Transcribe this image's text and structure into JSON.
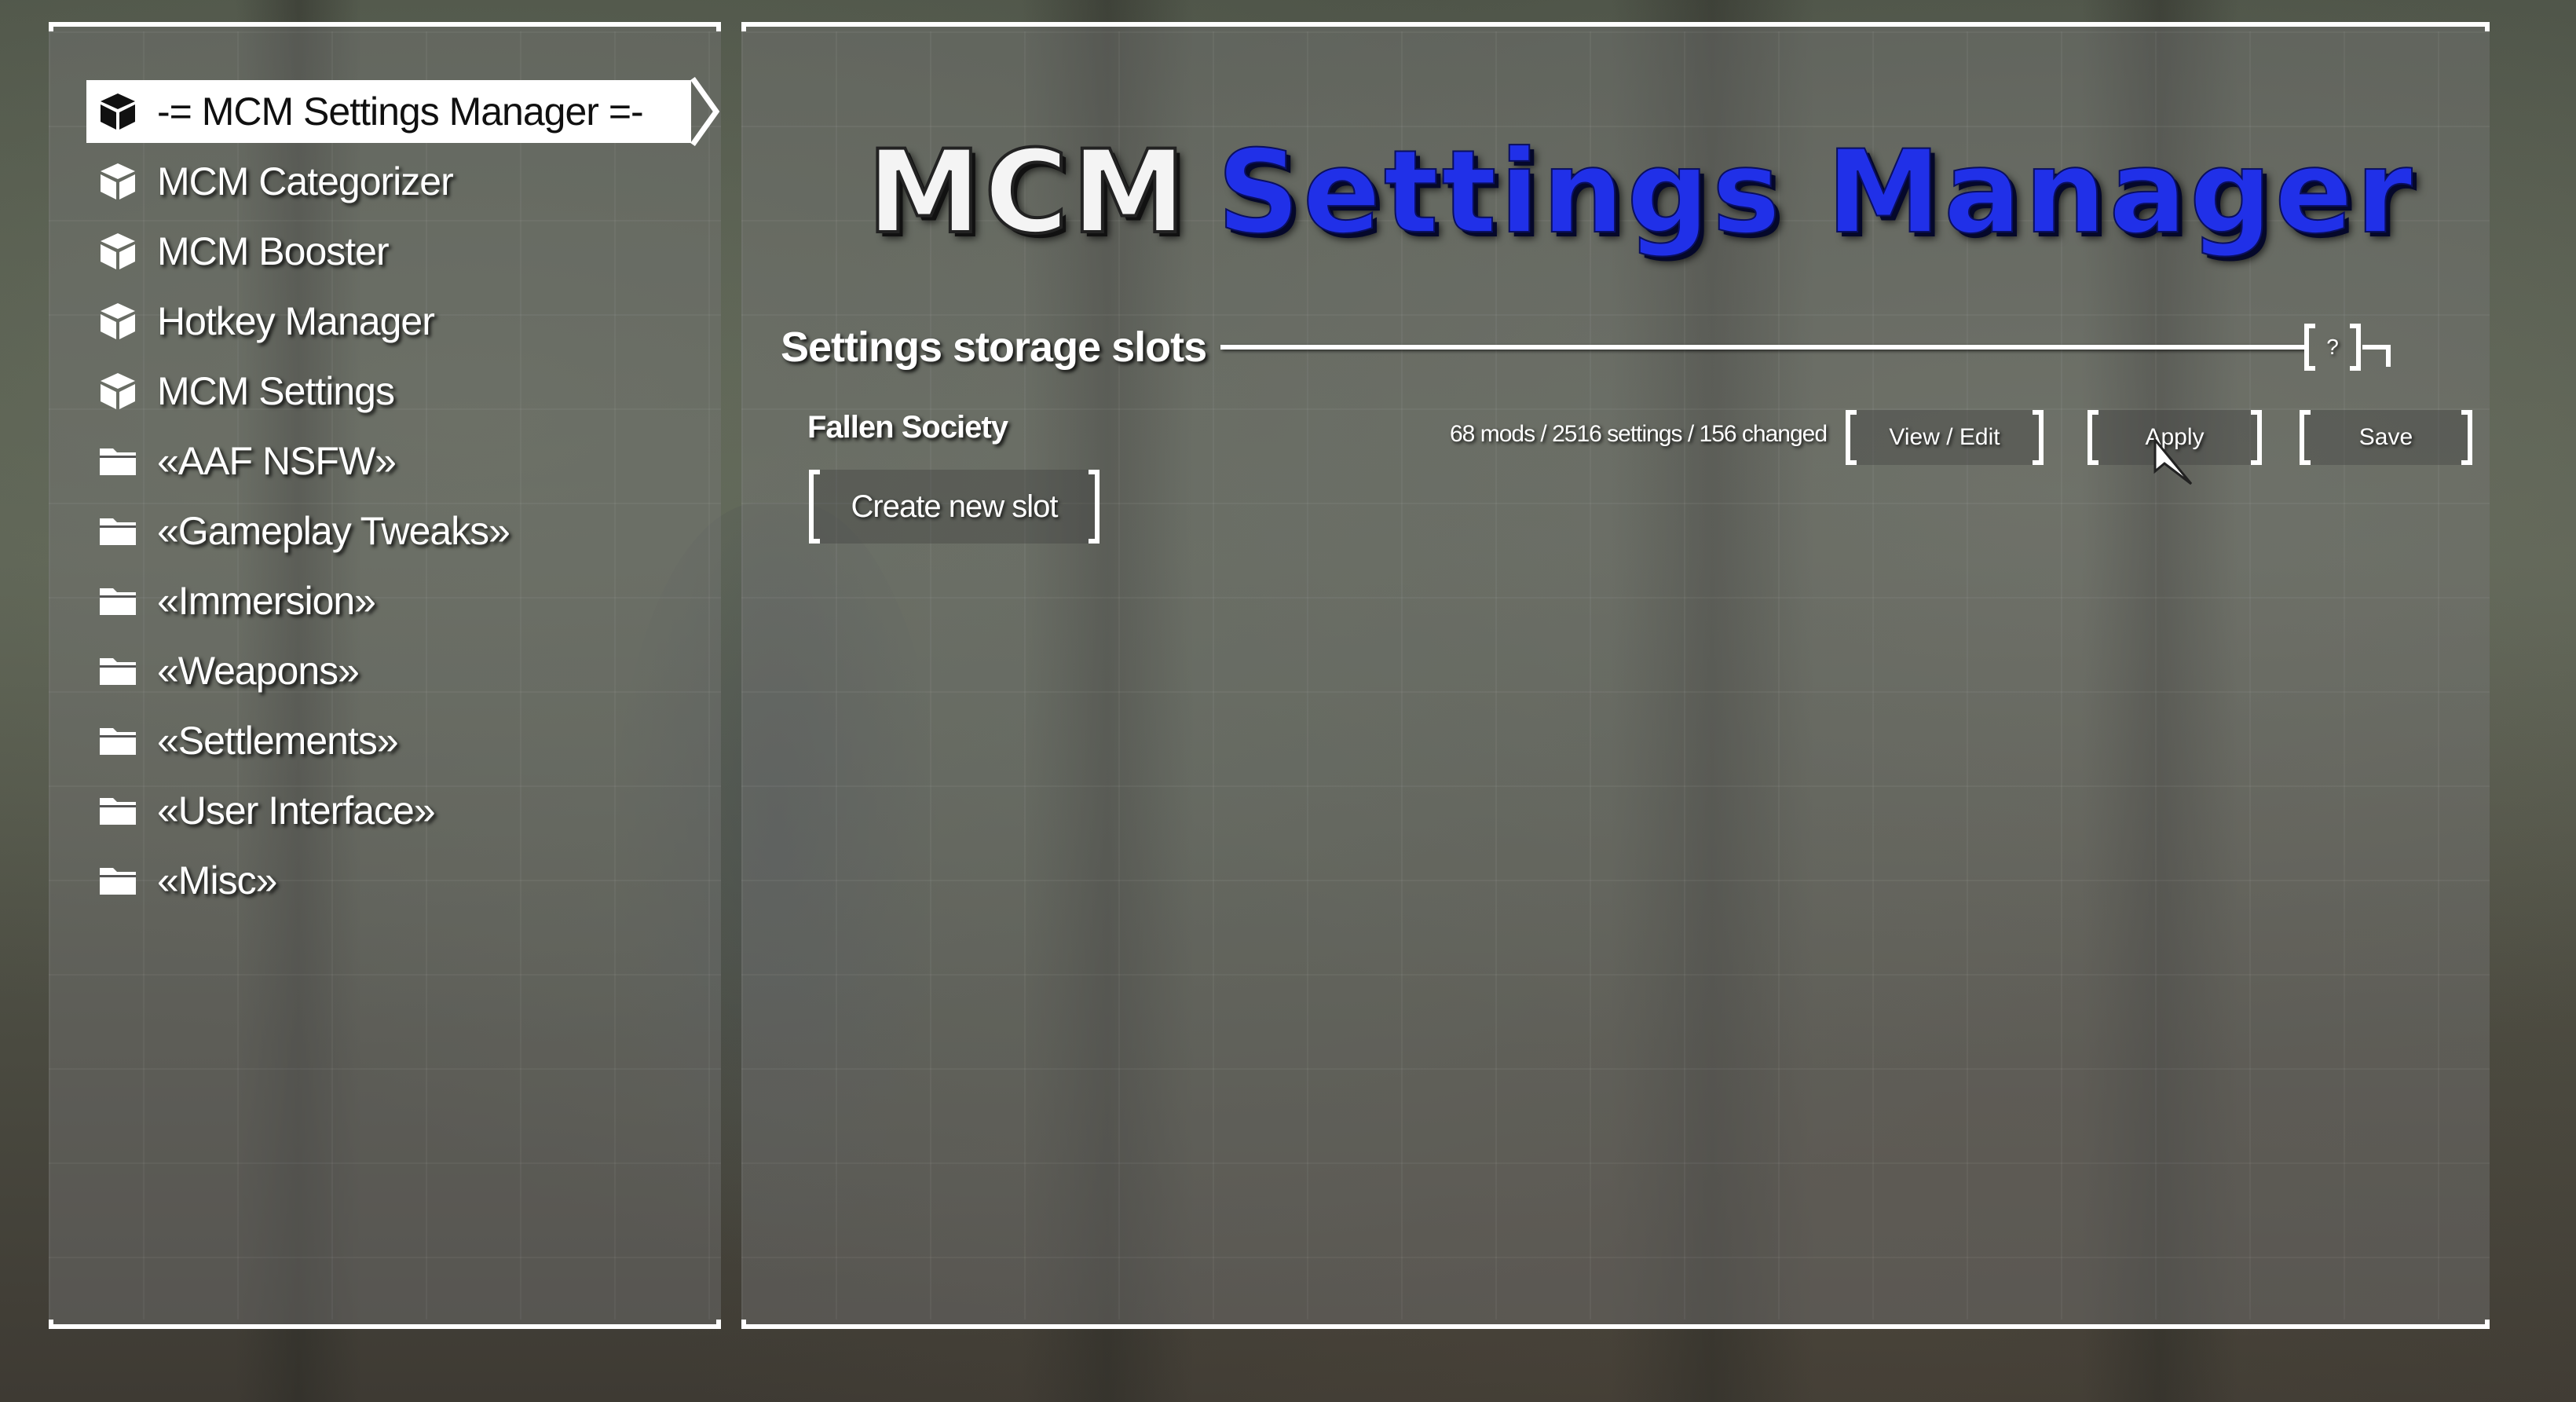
{
  "sidebar": {
    "items": [
      {
        "label": "-= MCM Settings Manager =-",
        "icon": "cube-icon",
        "selected": true
      },
      {
        "label": "MCM Categorizer",
        "icon": "cube-icon"
      },
      {
        "label": "MCM Booster",
        "icon": "cube-icon"
      },
      {
        "label": "Hotkey Manager",
        "icon": "cube-icon"
      },
      {
        "label": "MCM Settings",
        "icon": "cube-icon"
      },
      {
        "label": "«AAF NSFW»",
        "icon": "folder-icon"
      },
      {
        "label": "«Gameplay Tweaks»",
        "icon": "folder-icon"
      },
      {
        "label": "«Immersion»",
        "icon": "folder-icon"
      },
      {
        "label": "«Weapons»",
        "icon": "folder-icon"
      },
      {
        "label": "«Settlements»",
        "icon": "folder-icon"
      },
      {
        "label": "«User Interface»",
        "icon": "folder-icon"
      },
      {
        "label": "«Misc»",
        "icon": "folder-icon"
      }
    ]
  },
  "main": {
    "logo": {
      "part1": "MCM",
      "part2": "Settings Manager"
    },
    "section": {
      "title": "Settings storage slots",
      "help_label": "?"
    },
    "slots": [
      {
        "name": "Fallen Society",
        "stats": "68 mods / 2516 settings / 156 changed",
        "view_label": "View / Edit",
        "apply_label": "Apply",
        "save_label": "Save"
      }
    ],
    "create_label": "Create new slot"
  },
  "colors": {
    "accent_blue": "#2030e8",
    "frame": "#ffffff",
    "selected_bg": "#ffffff"
  }
}
